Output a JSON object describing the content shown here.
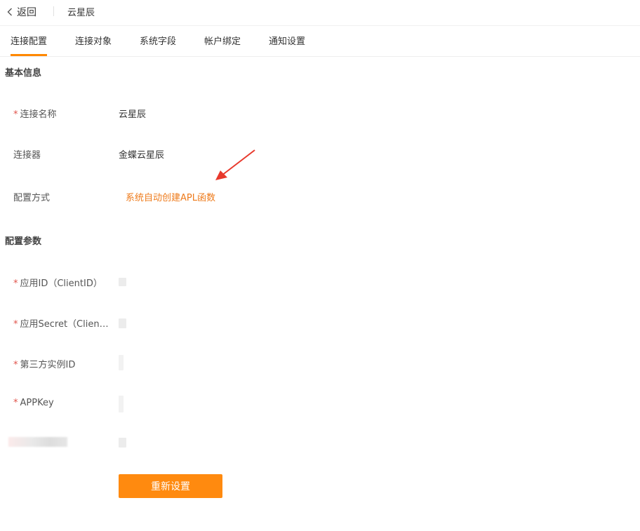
{
  "header": {
    "back_label": "返回",
    "connection_name": "云星辰"
  },
  "tabs": [
    {
      "label": "连接配置",
      "active": true
    },
    {
      "label": "连接对象",
      "active": false
    },
    {
      "label": "系统字段",
      "active": false
    },
    {
      "label": "帐户绑定",
      "active": false
    },
    {
      "label": "通知设置",
      "active": false
    }
  ],
  "basic_info": {
    "title": "基本信息",
    "fields": [
      {
        "label": "连接名称",
        "required": true,
        "value": "云星辰"
      },
      {
        "label": "连接器",
        "required": false,
        "value": "金蝶云星辰"
      },
      {
        "label": "配置方式",
        "required": false,
        "value": "系统自动创建APL函数"
      }
    ]
  },
  "config_params": {
    "title": "配置参数",
    "fields": [
      {
        "label": "应用ID（ClientID）",
        "required": true
      },
      {
        "label": "应用Secret（ClientSecret）",
        "required": true
      },
      {
        "label": "第三方实例ID",
        "required": true
      },
      {
        "label": "APPKey",
        "required": true
      }
    ]
  },
  "actions": {
    "reset_label": "重新设置"
  },
  "colors": {
    "accent": "#ff8a0f",
    "link": "#ee7a1a",
    "required": "#e0534a",
    "annotation_arrow": "#e8392c"
  },
  "icons": {
    "back": "chevron-left-icon",
    "annotation": "red-arrow-icon"
  }
}
